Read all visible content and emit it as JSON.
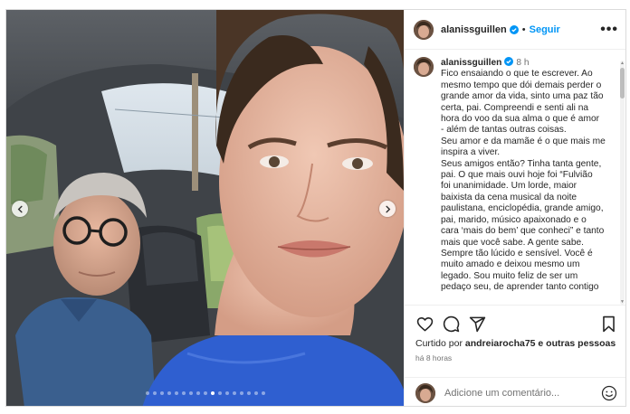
{
  "post": {
    "username": "alanissguillen",
    "follow_label": "Seguir",
    "more_label": "•••",
    "separator": "•"
  },
  "caption": {
    "username": "alanissguillen",
    "time": "8 h",
    "lines": [
      "Fico ensaiando o que te escrever. Ao",
      "mesmo tempo que dói demais perder o",
      "grande amor da vida, sinto uma paz tão",
      "certa, pai. Compreendi e senti ali na",
      "hora do voo da sua alma o que é amor",
      "- além de tantas outras coisas.",
      "Seu amor e da mamãe é o que mais me",
      "inspira a viver.",
      "Seus amigos então? Tinha tanta gente,",
      "pai. O que mais ouvi hoje foi “Fulvião",
      "foi unanimidade. Um lorde, maior",
      "baixista da cena musical da noite",
      "paulistana, enciclopédia, grande amigo,",
      "pai, marido, músico apaixonado e o",
      "cara ‘mais do bem’ que conheci” e tanto",
      "mais que você sabe. A gente sabe.",
      "Sempre tão lúcido e sensível. Você é",
      "muito amado e deixou mesmo um",
      "legado. Sou muito feliz de ser um",
      "pedaço seu, de aprender tanto contigo"
    ]
  },
  "actions": {
    "like_icon": "heart-icon",
    "comment_icon": "comment-icon",
    "share_icon": "share-icon",
    "save_icon": "bookmark-icon"
  },
  "likes": {
    "prefix": "Curtido por",
    "user": "andreiarocha75",
    "suffix": "e outras pessoas"
  },
  "post_age": "há 8 horas",
  "comment_box": {
    "placeholder": "Adicione um comentário..."
  },
  "carousel": {
    "slide_count": 17,
    "active_index": 9
  },
  "colors": {
    "accent": "#0095f6",
    "verified": "#0095f6",
    "muted": "#737373"
  }
}
